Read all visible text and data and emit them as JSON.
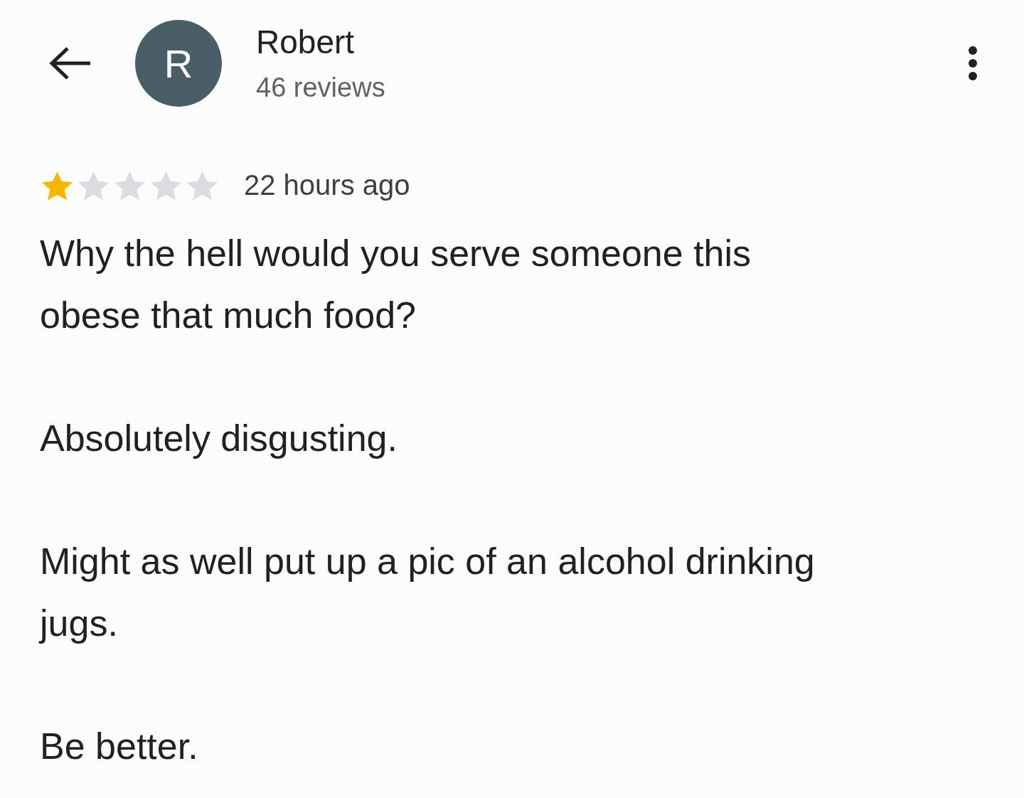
{
  "reviewer": {
    "initial": "R",
    "name": "Robert",
    "review_count": "46 reviews"
  },
  "review": {
    "stars": 1,
    "time": "22 hours ago",
    "paragraphs": [
      "Why the hell would you serve someone this obese that much food?",
      "Absolutely disgusting.",
      "Might as well put up a pic of an alcohol drinking jugs.",
      "Be better."
    ]
  }
}
